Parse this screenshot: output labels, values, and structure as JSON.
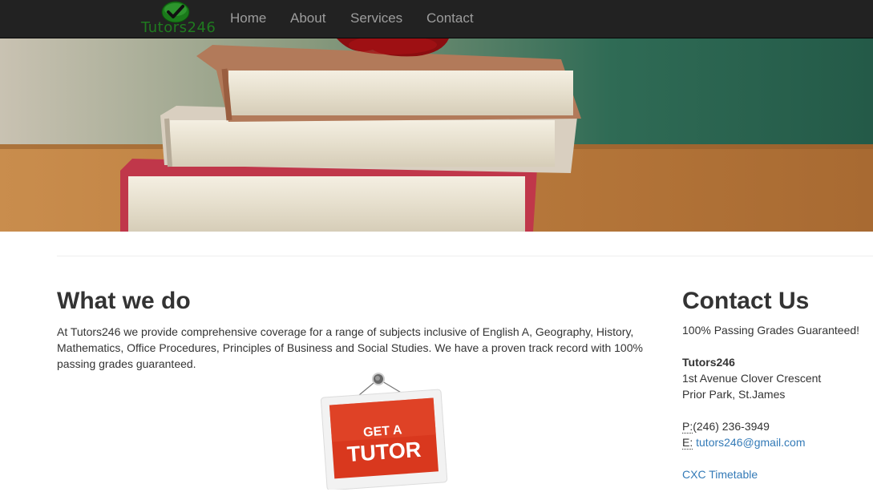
{
  "navbar": {
    "brand": "Tutors246",
    "brand_icon": "checkmark-icon",
    "items": [
      {
        "label": "Home"
      },
      {
        "label": "About"
      },
      {
        "label": "Services"
      },
      {
        "label": "Contact"
      }
    ]
  },
  "hero": {
    "image": "stack-of-books-with-apple"
  },
  "what_we_do": {
    "title": "What we do",
    "body": "At Tutors246 we provide comprehensive coverage for a range of subjects inclusive of English A, Geography, History, Mathematics, Office Procedures, Principles of Business and Social Studies. We have a proven track record with 100% passing grades guaranteed.",
    "sign_line1": "GET A",
    "sign_line2": "TUTOR"
  },
  "contact": {
    "title": "Contact Us",
    "tagline": "100% Passing Grades Guaranteed!",
    "name": "Tutors246",
    "address_line1": "1st Avenue Clover Crescent",
    "address_line2": "Prior Park, St.James",
    "phone_label": "P:",
    "phone": "(246) 236-3949",
    "email_label": "E:",
    "email": "tutors246@gmail.com",
    "timetable_link": "CXC Timetable"
  },
  "colors": {
    "navbar_bg": "#222222",
    "nav_text": "#9d9d9d",
    "link": "#337ab7",
    "sign_red": "#d9381e"
  }
}
